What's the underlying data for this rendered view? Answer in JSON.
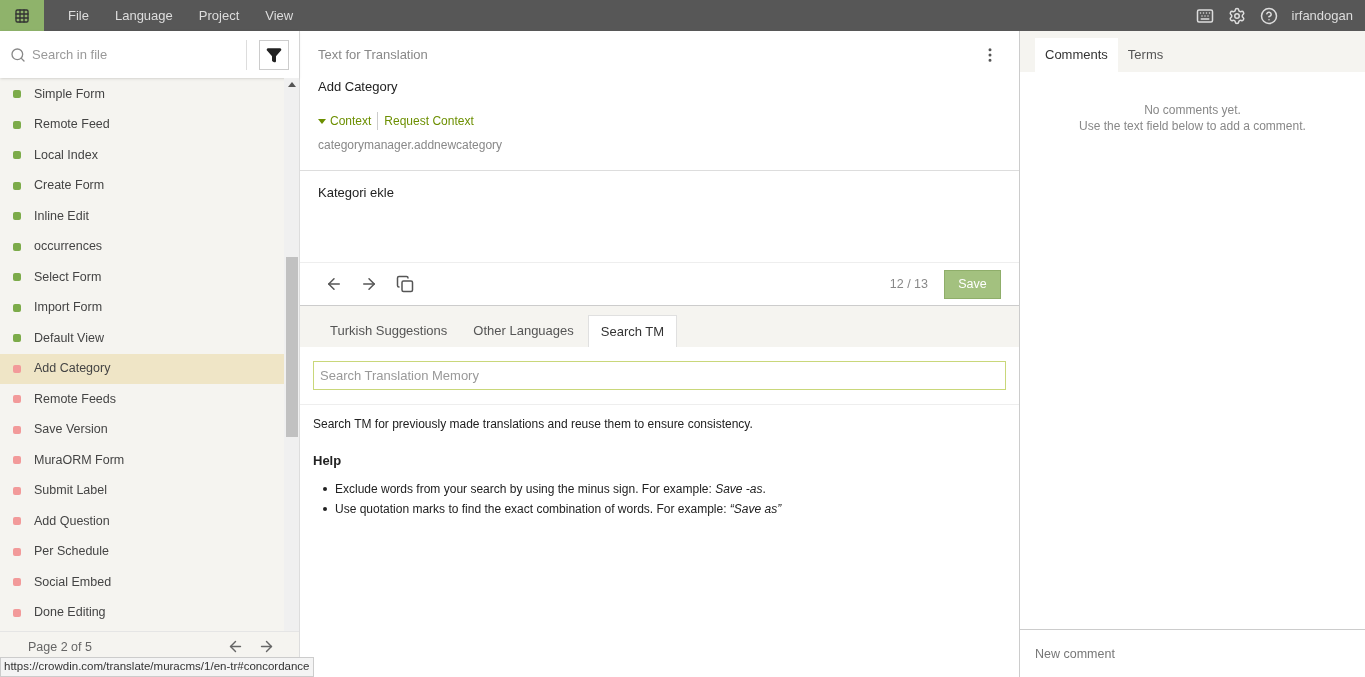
{
  "menu": [
    "File",
    "Language",
    "Project",
    "View"
  ],
  "user": "irfandogan",
  "sidebar": {
    "search_placeholder": "Search in file",
    "items": [
      {
        "label": "Simple Form",
        "kind": "translated",
        "selected": false
      },
      {
        "label": "Remote Feed",
        "kind": "translated",
        "selected": false
      },
      {
        "label": "Local Index",
        "kind": "translated",
        "selected": false
      },
      {
        "label": "Create Form",
        "kind": "translated",
        "selected": false
      },
      {
        "label": "Inline Edit",
        "kind": "translated",
        "selected": false
      },
      {
        "label": "occurrences",
        "kind": "translated",
        "selected": false
      },
      {
        "label": "Select Form",
        "kind": "translated",
        "selected": false
      },
      {
        "label": "Import Form",
        "kind": "translated",
        "selected": false
      },
      {
        "label": "Default View",
        "kind": "translated",
        "selected": false
      },
      {
        "label": "Add Category",
        "kind": "untranslated",
        "selected": true
      },
      {
        "label": "Remote Feeds",
        "kind": "untranslated",
        "selected": false
      },
      {
        "label": "Save Version",
        "kind": "untranslated",
        "selected": false
      },
      {
        "label": "MuraORM Form",
        "kind": "untranslated",
        "selected": false
      },
      {
        "label": "Submit Label",
        "kind": "untranslated",
        "selected": false
      },
      {
        "label": "Add Question",
        "kind": "untranslated",
        "selected": false
      },
      {
        "label": "Per Schedule",
        "kind": "untranslated",
        "selected": false
      },
      {
        "label": "Social Embed",
        "kind": "untranslated",
        "selected": false
      },
      {
        "label": "Done Editing",
        "kind": "untranslated",
        "selected": false
      }
    ],
    "page": "Page 2 of 5"
  },
  "status_url": "https://crowdin.com/translate/muracms/1/en-tr#concordance",
  "source": {
    "heading": "Text for Translation",
    "text": "Add Category",
    "context_toggle": "Context",
    "request_context": "Request Context",
    "key": "categorymanager.addnewcategory"
  },
  "translation": {
    "value": "Kategori ekle",
    "counter": "12 / 13",
    "save": "Save"
  },
  "tabs": [
    {
      "label": "Turkish Suggestions",
      "selected": false
    },
    {
      "label": "Other Languages",
      "selected": false
    },
    {
      "label": "Search TM",
      "selected": true
    }
  ],
  "tm": {
    "placeholder": "Search Translation Memory",
    "intro": "Search TM for previously made translations and reuse them to ensure consistency.",
    "help_title": "Help",
    "help_items": [
      "Exclude words from your search by using the minus sign. For example: *Save -as*.",
      "Use quotation marks to find the exact combination of words. For example: *“Save as”*"
    ]
  },
  "right_tabs": [
    {
      "label": "Comments",
      "selected": true
    },
    {
      "label": "Terms",
      "selected": false
    }
  ],
  "comments": {
    "empty_title": "No comments yet.",
    "empty_hint": "Use the text field below to add a comment.",
    "placeholder": "New comment"
  }
}
